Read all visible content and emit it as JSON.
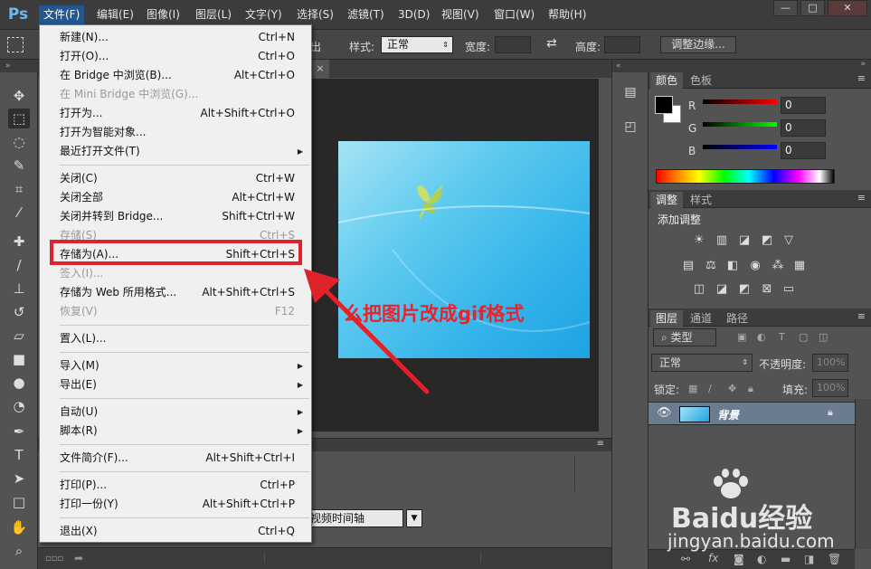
{
  "app": {
    "logo": "Ps"
  },
  "menubar": {
    "items": [
      "文件(F)",
      "编辑(E)",
      "图像(I)",
      "图层(L)",
      "文字(Y)",
      "选择(S)",
      "滤镜(T)",
      "3D(D)",
      "视图(V)",
      "窗口(W)",
      "帮助(H)"
    ],
    "active_index": 0,
    "window_buttons": [
      "—",
      "□",
      "✕"
    ]
  },
  "options_bar": {
    "partial_label": "出",
    "style_label": "样式:",
    "style_value": "正常",
    "width_label": "宽度:",
    "height_label": "高度:",
    "refine_edge": "调整边缘..."
  },
  "file_menu": {
    "items": [
      {
        "label": "新建(N)...",
        "shortcut": "Ctrl+N",
        "disabled": false
      },
      {
        "label": "打开(O)...",
        "shortcut": "Ctrl+O",
        "disabled": false
      },
      {
        "label": "在 Bridge 中浏览(B)...",
        "shortcut": "Alt+Ctrl+O",
        "disabled": false
      },
      {
        "label": "在 Mini Bridge 中浏览(G)...",
        "shortcut": "",
        "disabled": true
      },
      {
        "label": "打开为...",
        "shortcut": "Alt+Shift+Ctrl+O",
        "disabled": false
      },
      {
        "label": "打开为智能对象...",
        "shortcut": "",
        "disabled": false
      },
      {
        "label": "最近打开文件(T)",
        "shortcut": "",
        "disabled": false,
        "submenu": true
      },
      {
        "label": "关闭(C)",
        "shortcut": "Ctrl+W",
        "disabled": false
      },
      {
        "label": "关闭全部",
        "shortcut": "Alt+Ctrl+W",
        "disabled": false
      },
      {
        "label": "关闭并转到 Bridge...",
        "shortcut": "Shift+Ctrl+W",
        "disabled": false
      },
      {
        "label": "存储(S)",
        "shortcut": "Ctrl+S",
        "disabled": true
      },
      {
        "label": "存储为(A)...",
        "shortcut": "Shift+Ctrl+S",
        "disabled": false,
        "highlighted": true
      },
      {
        "label": "签入(I)...",
        "shortcut": "",
        "disabled": true
      },
      {
        "label": "存储为 Web 所用格式...",
        "shortcut": "Alt+Shift+Ctrl+S",
        "disabled": false
      },
      {
        "label": "恢复(V)",
        "shortcut": "F12",
        "disabled": true
      },
      {
        "label": "置入(L)...",
        "shortcut": "",
        "disabled": false
      },
      {
        "label": "导入(M)",
        "shortcut": "",
        "disabled": false,
        "submenu": true
      },
      {
        "label": "导出(E)",
        "shortcut": "",
        "disabled": false,
        "submenu": true
      },
      {
        "label": "自动(U)",
        "shortcut": "",
        "disabled": false,
        "submenu": true
      },
      {
        "label": "脚本(R)",
        "shortcut": "",
        "disabled": false,
        "submenu": true
      },
      {
        "label": "文件简介(F)...",
        "shortcut": "Alt+Shift+Ctrl+I",
        "disabled": false
      },
      {
        "label": "打印(P)...",
        "shortcut": "Ctrl+P",
        "disabled": false
      },
      {
        "label": "打印一份(Y)",
        "shortcut": "Alt+Shift+Ctrl+P",
        "disabled": false
      },
      {
        "label": "退出(X)",
        "shortcut": "Ctrl+Q",
        "disabled": false
      }
    ]
  },
  "document": {
    "caption": "么把图片改成gif格式",
    "caption_color": "#e8232b"
  },
  "timeline": {
    "button_label": "视频时间轴"
  },
  "color_panel": {
    "tabs": [
      "颜色",
      "色板"
    ],
    "channels": [
      {
        "label": "R",
        "value": "0",
        "color": "#e02020"
      },
      {
        "label": "G",
        "value": "0",
        "color": "#20c020"
      },
      {
        "label": "B",
        "value": "0",
        "color": "#2040e0"
      }
    ]
  },
  "adjustments_panel": {
    "tabs": [
      "调整",
      "样式"
    ],
    "title": "添加调整"
  },
  "layers_panel": {
    "tabs": [
      "图层",
      "通道",
      "路径"
    ],
    "kind_filter": "类型",
    "blend_mode": "正常",
    "opacity_label": "不透明度:",
    "opacity_value": "100%",
    "lock_label": "锁定:",
    "fill_label": "填充:",
    "fill_value": "100%",
    "layer_name": "背景"
  },
  "watermark": {
    "brand": "Baidu经验",
    "url": "jingyan.baidu.com"
  },
  "highlight_color": "#e0232b"
}
